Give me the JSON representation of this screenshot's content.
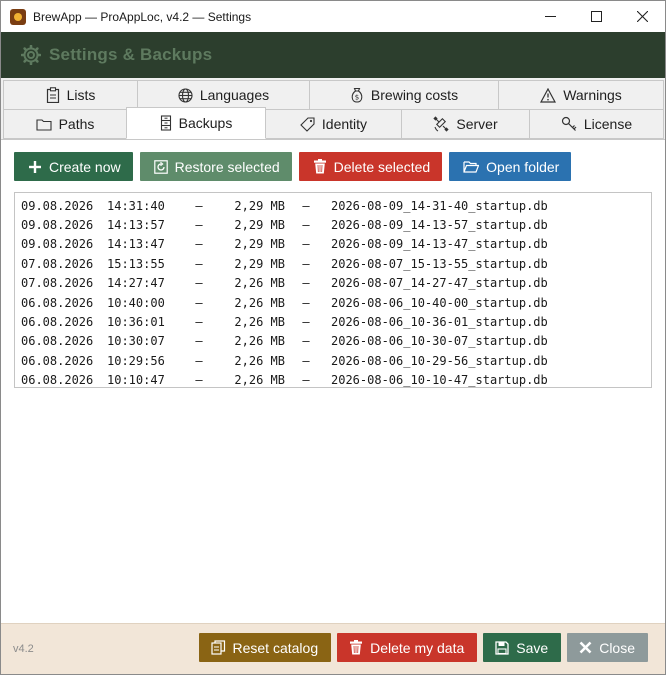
{
  "window": {
    "title": "BrewApp — ProAppLoc, v4.2 — Settings",
    "controls": {
      "minimize": "—",
      "maximize": "☐",
      "close": "✕"
    }
  },
  "header": {
    "title": "Settings & Backups",
    "icon": "gear-icon"
  },
  "tabs": {
    "row1": [
      {
        "label": "Lists",
        "icon": "clipboard-icon"
      },
      {
        "label": "Languages",
        "icon": "globe-icon"
      },
      {
        "label": "Brewing costs",
        "icon": "money-bag-icon"
      },
      {
        "label": "Warnings",
        "icon": "warning-triangle-icon"
      }
    ],
    "row2": [
      {
        "label": "Paths",
        "icon": "folder-icon"
      },
      {
        "label": "Backups",
        "icon": "archive-icon",
        "active": true
      },
      {
        "label": "Identity",
        "icon": "tag-icon"
      },
      {
        "label": "Server",
        "icon": "satellite-icon"
      },
      {
        "label": "License",
        "icon": "key-icon"
      }
    ]
  },
  "toolbar": {
    "create_now": "Create now",
    "restore_selected": "Restore selected",
    "delete_selected": "Delete selected",
    "open_folder": "Open folder"
  },
  "backups": {
    "separator": "—",
    "rows": [
      {
        "date": "09.08.2026",
        "time": "14:31:40",
        "size": "2,29 MB",
        "file": "2026-08-09_14-31-40_startup.db"
      },
      {
        "date": "09.08.2026",
        "time": "14:13:57",
        "size": "2,29 MB",
        "file": "2026-08-09_14-13-57_startup.db"
      },
      {
        "date": "09.08.2026",
        "time": "14:13:47",
        "size": "2,29 MB",
        "file": "2026-08-09_14-13-47_startup.db"
      },
      {
        "date": "07.08.2026",
        "time": "15:13:55",
        "size": "2,29 MB",
        "file": "2026-08-07_15-13-55_startup.db"
      },
      {
        "date": "07.08.2026",
        "time": "14:27:47",
        "size": "2,26 MB",
        "file": "2026-08-07_14-27-47_startup.db"
      },
      {
        "date": "06.08.2026",
        "time": "10:40:00",
        "size": "2,26 MB",
        "file": "2026-08-06_10-40-00_startup.db"
      },
      {
        "date": "06.08.2026",
        "time": "10:36:01",
        "size": "2,26 MB",
        "file": "2026-08-06_10-36-01_startup.db"
      },
      {
        "date": "06.08.2026",
        "time": "10:30:07",
        "size": "2,26 MB",
        "file": "2026-08-06_10-30-07_startup.db"
      },
      {
        "date": "06.08.2026",
        "time": "10:29:56",
        "size": "2,26 MB",
        "file": "2026-08-06_10-29-56_startup.db"
      },
      {
        "date": "06.08.2026",
        "time": "10:10:47",
        "size": "2,26 MB",
        "file": "2026-08-06_10-10-47_startup.db"
      }
    ]
  },
  "footer": {
    "version": "v4.2",
    "reset_catalog": "Reset catalog",
    "delete_my_data": "Delete my data",
    "save": "Save",
    "close": "Close"
  },
  "colors": {
    "header_bg": "#2c3e2d",
    "header_text": "#5e7a5f",
    "primary_green": "#2e6b4a",
    "sage": "#5f8c6b",
    "danger_red": "#c9352a",
    "info_blue": "#2b72b0",
    "brown": "#8a6414",
    "grey": "#8e9a9b",
    "footer_bg": "#f2e6d8"
  }
}
